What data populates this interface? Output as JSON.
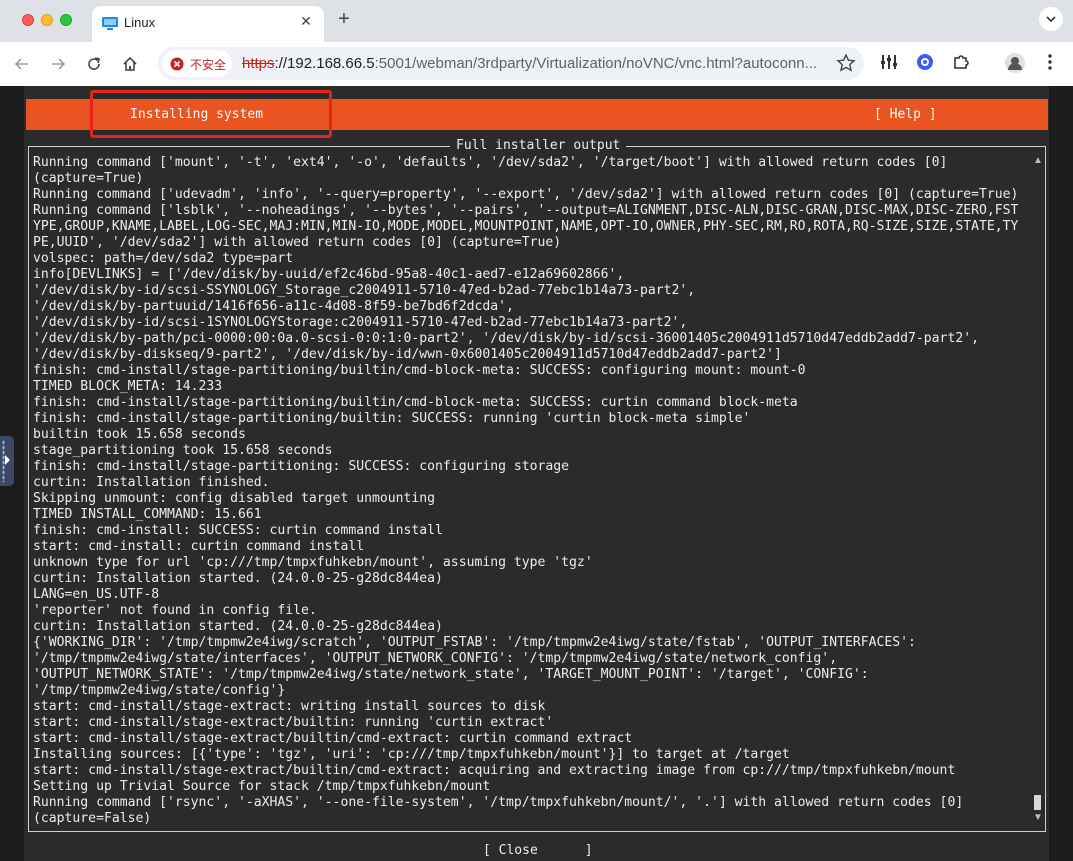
{
  "browser": {
    "tab_title": "Linux",
    "new_tab": "+",
    "security_label": "不安全",
    "url_scheme": "https",
    "url_host": "://192.168.66.5",
    "url_rest": ":5001/webman/3rdparty/Virtualization/noVNC/vnc.html?autoconn..."
  },
  "installer": {
    "title": "Installing system",
    "help": "[ Help ]",
    "frame_title": "Full installer output",
    "close": "[ Close      ]",
    "log_lines": [
      "Running command ['mount', '-t', 'ext4', '-o', 'defaults', '/dev/sda2', '/target/boot'] with allowed return codes [0]",
      "(capture=True)",
      "Running command ['udevadm', 'info', '--query=property', '--export', '/dev/sda2'] with allowed return codes [0] (capture=True)",
      "Running command ['lsblk', '--noheadings', '--bytes', '--pairs', '--output=ALIGNMENT,DISC-ALN,DISC-GRAN,DISC-MAX,DISC-ZERO,FST",
      "YPE,GROUP,KNAME,LABEL,LOG-SEC,MAJ:MIN,MIN-IO,MODE,MODEL,MOUNTPOINT,NAME,OPT-IO,OWNER,PHY-SEC,RM,RO,ROTA,RQ-SIZE,SIZE,STATE,TY",
      "PE,UUID', '/dev/sda2'] with allowed return codes [0] (capture=True)",
      "volspec: path=/dev/sda2 type=part",
      "info[DEVLINKS] = ['/dev/disk/by-uuid/ef2c46bd-95a8-40c1-aed7-e12a69602866',",
      "'/dev/disk/by-id/scsi-SSYNOLOGY_Storage_c2004911-5710-47ed-b2ad-77ebc1b14a73-part2',",
      "'/dev/disk/by-partuuid/1416f656-a11c-4d08-8f59-be7bd6f2dcda',",
      "'/dev/disk/by-id/scsi-1SYNOLOGYStorage:c2004911-5710-47ed-b2ad-77ebc1b14a73-part2',",
      "'/dev/disk/by-path/pci-0000:00:0a.0-scsi-0:0:1:0-part2', '/dev/disk/by-id/scsi-36001405c2004911d5710d47eddb2add7-part2',",
      "'/dev/disk/by-diskseq/9-part2', '/dev/disk/by-id/wwn-0x6001405c2004911d5710d47eddb2add7-part2']",
      "finish: cmd-install/stage-partitioning/builtin/cmd-block-meta: SUCCESS: configuring mount: mount-0",
      "TIMED BLOCK_META: 14.233",
      "finish: cmd-install/stage-partitioning/builtin/cmd-block-meta: SUCCESS: curtin command block-meta",
      "finish: cmd-install/stage-partitioning/builtin: SUCCESS: running 'curtin block-meta simple'",
      "builtin took 15.658 seconds",
      "stage_partitioning took 15.658 seconds",
      "finish: cmd-install/stage-partitioning: SUCCESS: configuring storage",
      "curtin: Installation finished.",
      "Skipping unmount: config disabled target unmounting",
      "TIMED INSTALL_COMMAND: 15.661",
      "finish: cmd-install: SUCCESS: curtin command install",
      "start: cmd-install: curtin command install",
      "unknown type for url 'cp:///tmp/tmpxfuhkebn/mount', assuming type 'tgz'",
      "curtin: Installation started. (24.0.0-25-g28dc844ea)",
      "LANG=en_US.UTF-8",
      "'reporter' not found in config file.",
      "curtin: Installation started. (24.0.0-25-g28dc844ea)",
      "{'WORKING_DIR': '/tmp/tmpmw2e4iwg/scratch', 'OUTPUT_FSTAB': '/tmp/tmpmw2e4iwg/state/fstab', 'OUTPUT_INTERFACES':",
      "'/tmp/tmpmw2e4iwg/state/interfaces', 'OUTPUT_NETWORK_CONFIG': '/tmp/tmpmw2e4iwg/state/network_config',",
      "'OUTPUT_NETWORK_STATE': '/tmp/tmpmw2e4iwg/state/network_state', 'TARGET_MOUNT_POINT': '/target', 'CONFIG':",
      "'/tmp/tmpmw2e4iwg/state/config'}",
      "start: cmd-install/stage-extract: writing install sources to disk",
      "start: cmd-install/stage-extract/builtin: running 'curtin extract'",
      "start: cmd-install/stage-extract/builtin/cmd-extract: curtin command extract",
      "Installing sources: [{'type': 'tgz', 'uri': 'cp:///tmp/tmpxfuhkebn/mount'}] to target at /target",
      "start: cmd-install/stage-extract/builtin/cmd-extract: acquiring and extracting image from cp:///tmp/tmpxfuhkebn/mount",
      "Setting up Trivial Source for stack /tmp/tmpxfuhkebn/mount",
      "Running command ['rsync', '-aXHAS', '--one-file-system', '/tmp/tmpxfuhkebn/mount/', '.'] with allowed return codes [0]",
      "(capture=False)"
    ]
  }
}
